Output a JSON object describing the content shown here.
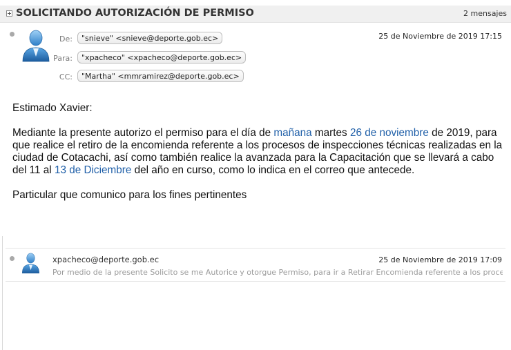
{
  "thread": {
    "subject": "SOLICITANDO AUTORIZACIÓN DE PERMISO",
    "count": "2 mensajes"
  },
  "message1": {
    "from_label": "De:",
    "from": "\"snieve\" <snieve@deporte.gob.ec>",
    "to_label": "Para:",
    "to": "\"xpacheco\" <xpacheco@deporte.gob.ec>",
    "cc_label": "CC:",
    "cc": "\"Martha\" <mmramirez@deporte.gob.ec>",
    "date": "25 de Noviembre de 2019 17:15",
    "greeting": "Estimado Xavier:",
    "para1": {
      "t1": "Mediante la presente autorizo el permiso para el día de ",
      "l1": "mañana",
      "t2": " martes ",
      "l2": "26 de noviembre",
      "t3": " de 2019, para que realice el retiro de la encomienda referente a los procesos de inspecciones técnicas realizadas en la ciudad de Cotacachi, así como también realice la avanzada para la Capacitación que se llevará a cabo del 11 al ",
      "l3": "13 de Diciembre",
      "t4": " del año en curso, como lo indica en el correo que antecede."
    },
    "closing": "Particular que comunico para los fines pertinentes"
  },
  "message2": {
    "from": "xpacheco@deporte.gob.ec",
    "date": "25 de Noviembre de 2019 17:09",
    "snippet": "Por medio de la presente Solicito se me Autorice y otorgue Permiso, para ir a Retirar Encomienda referente a los procesos de"
  },
  "icons": {
    "expand": "expand-plus-icon",
    "avatar": "user-avatar-icon",
    "unread": "status-dot-icon"
  },
  "colors": {
    "link": "#1f5fa8",
    "header_bg": "#f0f0f0"
  }
}
